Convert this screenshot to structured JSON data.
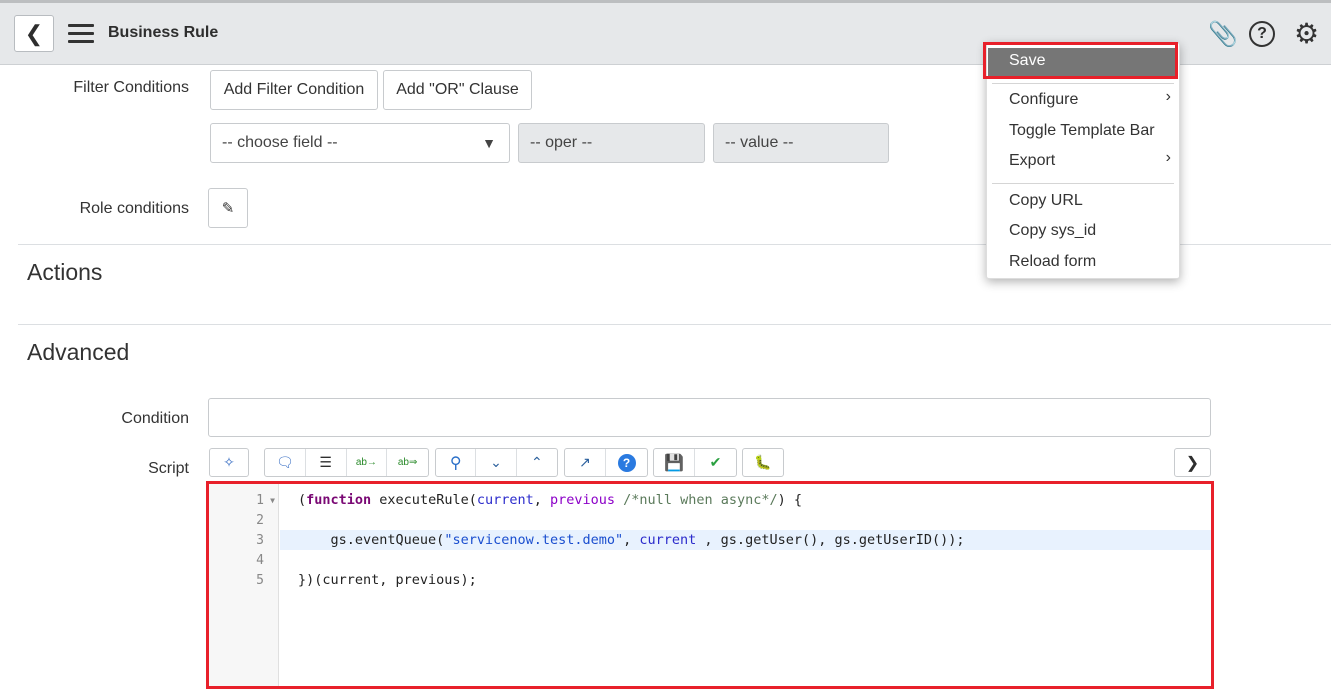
{
  "header": {
    "title": "Business Rule"
  },
  "filter": {
    "label": "Filter Conditions",
    "add_filter": "Add Filter Condition",
    "add_or": "Add \"OR\" Clause",
    "field": "-- choose field --",
    "oper": "-- oper --",
    "value": "-- value --"
  },
  "role": {
    "label": "Role conditions"
  },
  "sections": {
    "actions": "Actions",
    "advanced": "Advanced"
  },
  "condition": {
    "label": "Condition",
    "value": ""
  },
  "script": {
    "label": "Script",
    "line_numbers": [
      "1",
      "2",
      "3",
      "4",
      "5"
    ],
    "lines": {
      "l1a": "(",
      "l1kw": "function",
      "l1b": " executeRule(",
      "l1v1": "current",
      "l1c": ", ",
      "l1v2": "previous",
      "l1cm": " /*null when async*/",
      "l1d": ") {",
      "l3a": "    gs.eventQueue(",
      "l3s": "\"servicenow.test.demo\"",
      "l3b": ", ",
      "l3v": "current",
      "l3c": " , gs.getUser(), gs.getUserID());",
      "l5": "})(current, previous);"
    }
  },
  "menu": {
    "items": [
      "Save",
      "Configure",
      "Toggle Template Bar",
      "Export",
      "Copy URL",
      "Copy sys_id",
      "Reload form"
    ]
  },
  "colors": {
    "highlight": "#e8202a",
    "save_bg": "#767676"
  }
}
